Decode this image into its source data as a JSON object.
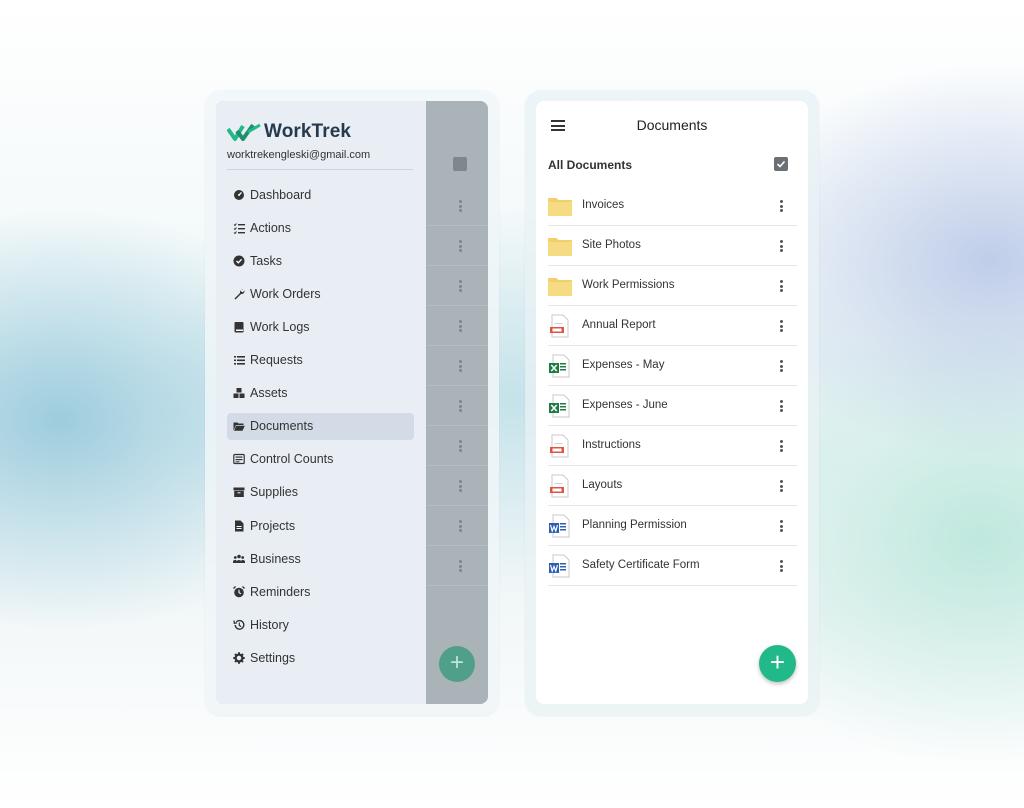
{
  "brand": {
    "name": "WorkTrek",
    "email": "worktrekengleski@gmail.com"
  },
  "drawer": {
    "items": [
      {
        "label": "Dashboard",
        "icon": "dashboard-icon"
      },
      {
        "label": "Actions",
        "icon": "actions-icon"
      },
      {
        "label": "Tasks",
        "icon": "tasks-icon"
      },
      {
        "label": "Work Orders",
        "icon": "wrench-icon"
      },
      {
        "label": "Work Logs",
        "icon": "book-icon"
      },
      {
        "label": "Requests",
        "icon": "list-icon"
      },
      {
        "label": "Assets",
        "icon": "assets-icon"
      },
      {
        "label": "Documents",
        "icon": "folder-open-icon"
      },
      {
        "label": "Control Counts",
        "icon": "counter-icon"
      },
      {
        "label": "Supplies",
        "icon": "box-icon"
      },
      {
        "label": "Projects",
        "icon": "file-icon"
      },
      {
        "label": "Business",
        "icon": "people-icon"
      },
      {
        "label": "Reminders",
        "icon": "alarm-icon"
      },
      {
        "label": "History",
        "icon": "history-icon"
      },
      {
        "label": "Settings",
        "icon": "gear-icon"
      }
    ],
    "active": "Documents"
  },
  "documents": {
    "title": "Documents",
    "section": "All Documents",
    "items": [
      {
        "label": "Invoices",
        "type": "folder"
      },
      {
        "label": "Site Photos",
        "type": "folder"
      },
      {
        "label": "Work Permissions",
        "type": "folder"
      },
      {
        "label": "Annual Report",
        "type": "pdf"
      },
      {
        "label": "Expenses - May",
        "type": "excel"
      },
      {
        "label": "Expenses - June",
        "type": "excel"
      },
      {
        "label": "Instructions",
        "type": "pdf"
      },
      {
        "label": "Layouts",
        "type": "pdf"
      },
      {
        "label": "Planning Permission",
        "type": "word"
      },
      {
        "label": "Safety Certificate Form",
        "type": "word"
      }
    ]
  },
  "fab": {
    "symbol": "+"
  },
  "colors": {
    "accent": "#22b98a",
    "brand_dark": "#253a4d",
    "active_bg": "#d3dbe7",
    "folder": "#f3cf6b"
  }
}
